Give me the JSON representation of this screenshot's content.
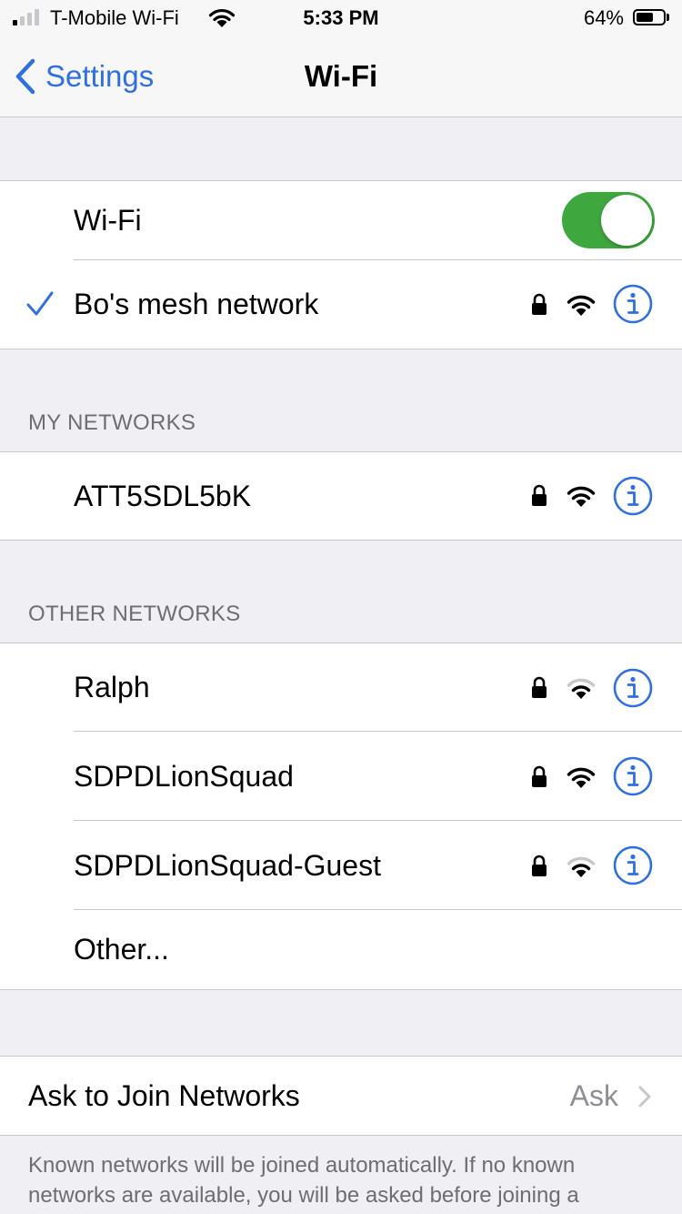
{
  "status_bar": {
    "carrier": "T-Mobile Wi-Fi",
    "time": "5:33 PM",
    "battery_percent": "64%",
    "battery_level": 0.64,
    "signal_bars_filled": 1,
    "icons": [
      "signal-icon",
      "wifi-icon",
      "battery-icon"
    ]
  },
  "nav": {
    "back_label": "Settings",
    "title": "Wi-Fi"
  },
  "wifi_toggle": {
    "label": "Wi-Fi",
    "on": true
  },
  "connected_network": {
    "name": "Bo's mesh network",
    "secured": true,
    "signal": "full"
  },
  "my_networks": {
    "header": "MY NETWORKS",
    "items": [
      {
        "name": "ATT5SDL5bK",
        "secured": true,
        "signal": "full"
      }
    ]
  },
  "other_networks": {
    "header": "OTHER NETWORKS",
    "items": [
      {
        "name": "Ralph",
        "secured": true,
        "signal": "weak"
      },
      {
        "name": "SDPDLionSquad",
        "secured": true,
        "signal": "full"
      },
      {
        "name": "SDPDLionSquad-Guest",
        "secured": true,
        "signal": "weak"
      }
    ],
    "other_label": "Other..."
  },
  "ask_to_join": {
    "label": "Ask to Join Networks",
    "value": "Ask"
  },
  "footer": "Known networks will be joined automatically. If no known networks are available, you will be asked before joining a",
  "colors": {
    "accent": "#2f6fe0",
    "toggle_on": "#3ea83e",
    "separator": "#c8c7cc",
    "background": "#efeff4",
    "secondary_text": "#6d6d72"
  }
}
